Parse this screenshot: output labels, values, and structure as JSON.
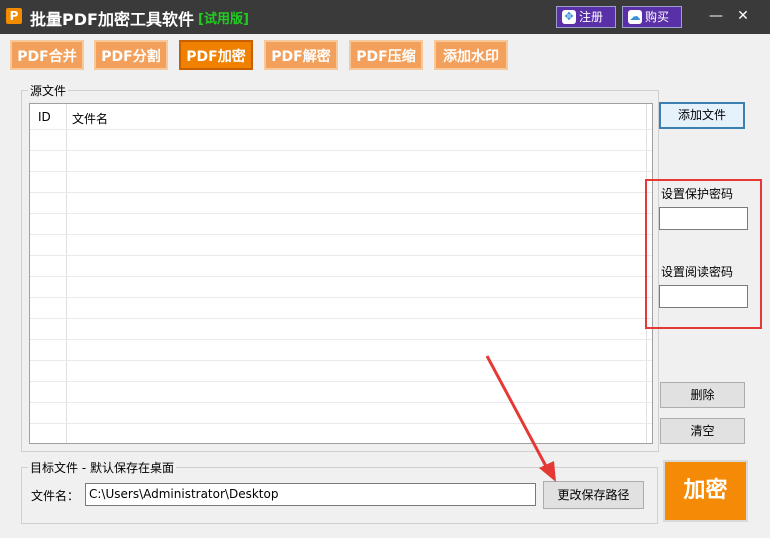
{
  "window": {
    "title": "批量PDF加密工具软件",
    "trial_badge": "[试用版]",
    "register_label": "注册",
    "buy_label": "购买",
    "minimize_glyph": "—",
    "close_glyph": "✕",
    "icon_letter": "P"
  },
  "tabs": [
    {
      "label": "PDF合并",
      "active": false
    },
    {
      "label": "PDF分割",
      "active": false
    },
    {
      "label": "PDF加密",
      "active": true
    },
    {
      "label": "PDF解密",
      "active": false
    },
    {
      "label": "PDF压缩",
      "active": false
    },
    {
      "label": "添加水印",
      "active": false
    }
  ],
  "source": {
    "legend": "源文件",
    "columns": [
      "ID",
      "文件名"
    ],
    "rows": []
  },
  "side": {
    "add_file": "添加文件",
    "protect_password_label": "设置保护密码",
    "protect_password_value": "",
    "read_password_label": "设置阅读密码",
    "read_password_value": "",
    "delete": "删除",
    "clear": "清空"
  },
  "target": {
    "legend": "目标文件 - 默认保存在桌面",
    "filename_label": "文件名：",
    "path_value": "C:\\Users\\Administrator\\Desktop",
    "change_path": "更改保存路径"
  },
  "encrypt_label": "加密",
  "colors": {
    "titlebar": "#3a3a3a",
    "tab": "#f2a05c",
    "tab_active": "#f08000",
    "encrypt": "#f58a07",
    "highlight": "#e53935",
    "trial": "#22cc22"
  }
}
